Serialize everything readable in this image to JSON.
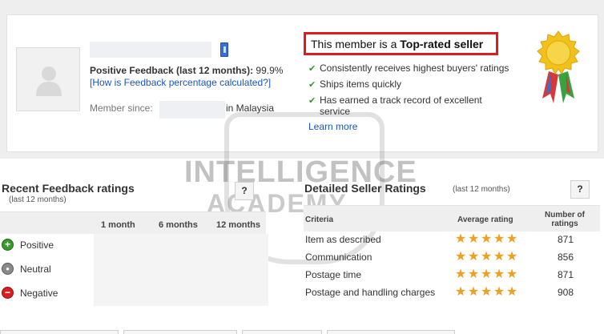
{
  "profile": {
    "feedback_label": "Positive Feedback (last 12 months):",
    "feedback_value": "99.9%",
    "how_calc_link": "[How is Feedback percentage calculated?]",
    "member_since_label": "Member since:",
    "location": "in Malaysia"
  },
  "top_rated": {
    "prefix": "This member is a ",
    "highlight": "Top-rated seller",
    "bullets": [
      "Consistently receives highest buyers' ratings",
      "Ships items quickly",
      "Has earned a track record of excellent service"
    ],
    "learn_more": "Learn more"
  },
  "watermark": {
    "line1": "INTELLIGENCE",
    "line2": "ACADEMY"
  },
  "recent_feedback": {
    "title": "Recent Feedback ratings",
    "subtitle": "(last 12 months)",
    "help": "?",
    "columns": [
      "1 month",
      "6 months",
      "12 months"
    ],
    "rows": [
      {
        "label": "Positive",
        "symbol": "+",
        "color": "#3a9a2e"
      },
      {
        "label": "Neutral",
        "symbol": "●",
        "color": "#8a8a8a"
      },
      {
        "label": "Negative",
        "symbol": "−",
        "color": "#d42020"
      }
    ]
  },
  "detailed_ratings": {
    "title": "Detailed Seller Ratings",
    "subtitle": "(last 12 months)",
    "help": "?",
    "col_criteria": "Criteria",
    "col_average": "Average rating",
    "col_number": "Number of ratings",
    "star_color": "#f0a020",
    "rows": [
      {
        "criteria": "Item as described",
        "stars": 5,
        "count": "871"
      },
      {
        "criteria": "Communication",
        "stars": 5,
        "count": "856"
      },
      {
        "criteria": "Postage time",
        "stars": 5,
        "count": "871"
      },
      {
        "criteria": "Postage and handling charges",
        "stars": 5,
        "count": "908"
      }
    ]
  }
}
